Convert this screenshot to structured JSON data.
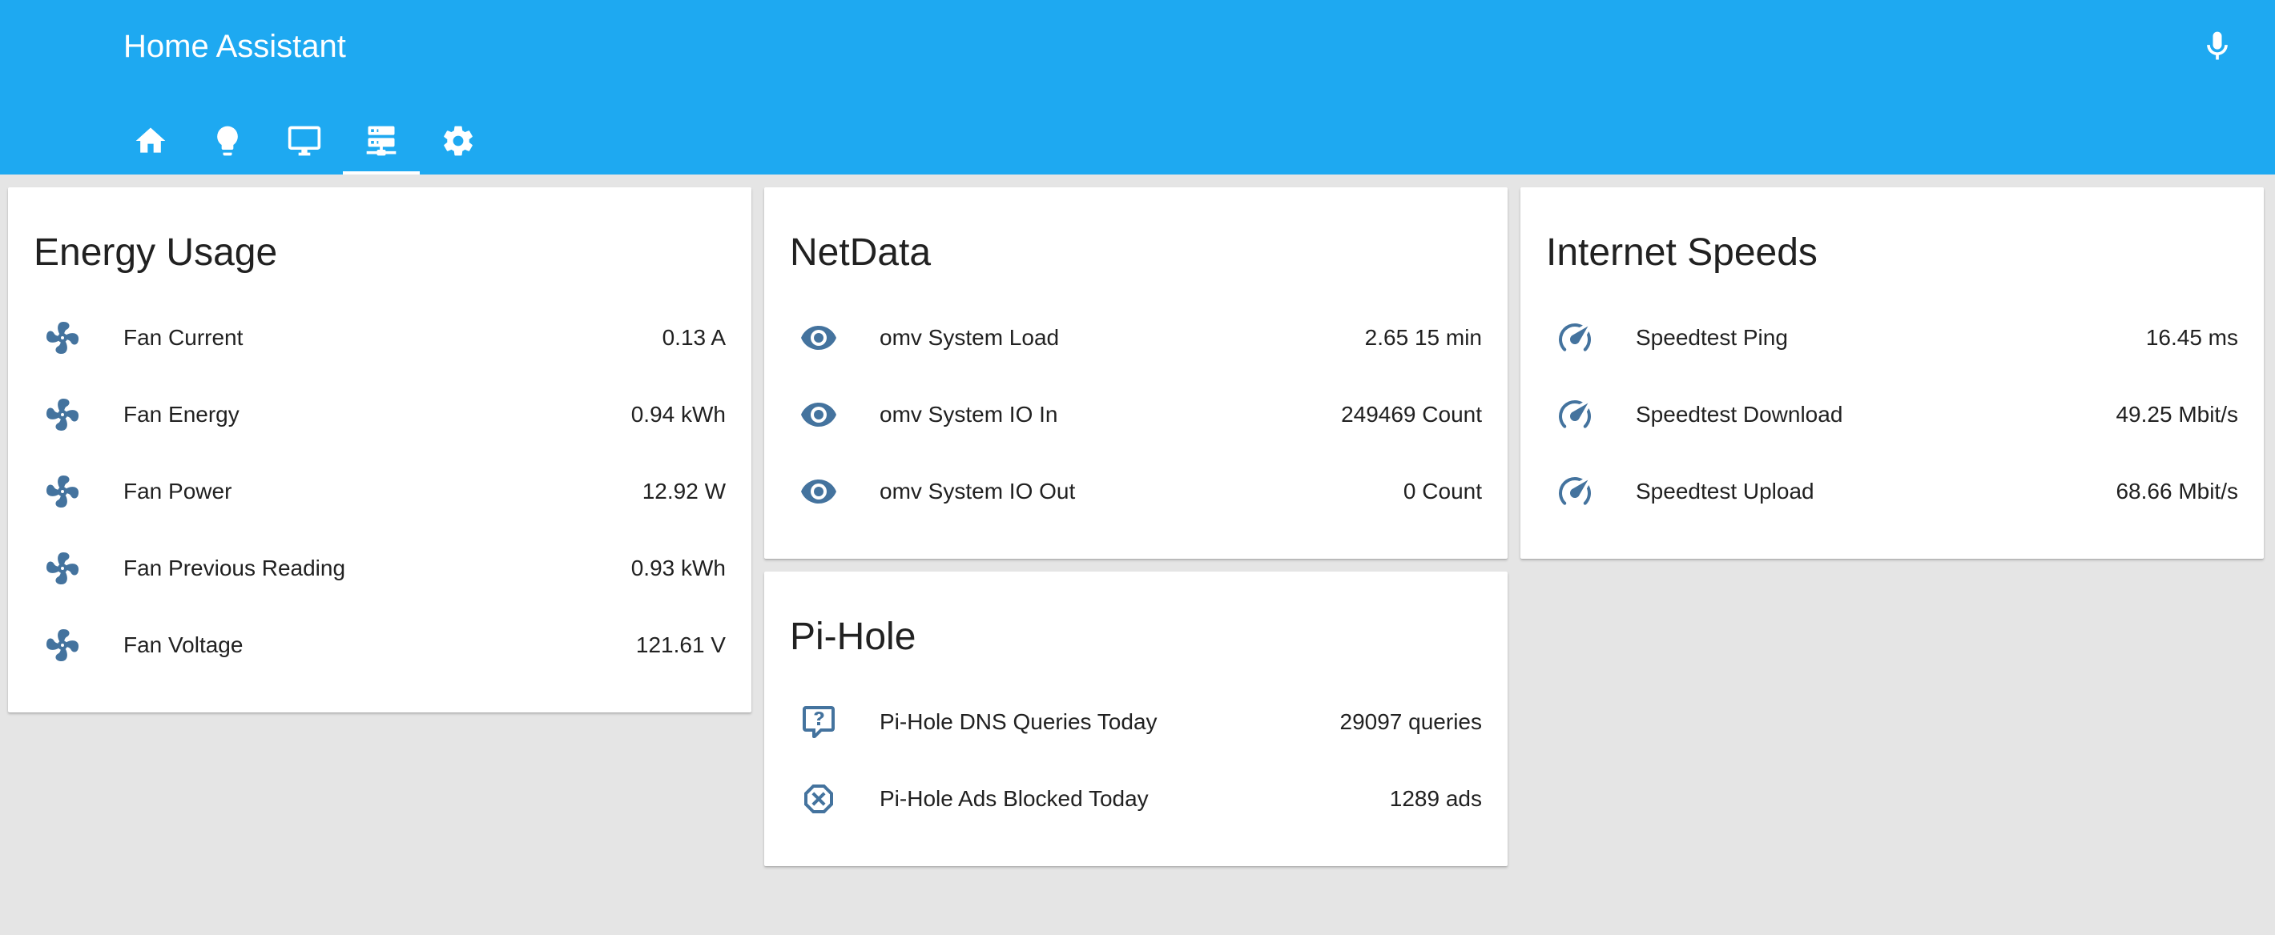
{
  "app": {
    "title": "Home Assistant"
  },
  "colors": {
    "header": "#1ea9f1",
    "icon": "#44739e",
    "background": "#e5e5e5"
  },
  "header": {
    "mic_icon": "microphone-icon",
    "tabs": [
      {
        "icon": "home-icon",
        "active": false
      },
      {
        "icon": "lightbulb-icon",
        "active": false
      },
      {
        "icon": "monitor-icon",
        "active": false
      },
      {
        "icon": "server-network-icon",
        "active": true
      },
      {
        "icon": "gear-icon",
        "active": false
      }
    ]
  },
  "cards": {
    "energy": {
      "title": "Energy Usage",
      "rows": [
        {
          "icon": "fan-icon",
          "label": "Fan Current",
          "value": "0.13 A"
        },
        {
          "icon": "fan-icon",
          "label": "Fan Energy",
          "value": "0.94 kWh"
        },
        {
          "icon": "fan-icon",
          "label": "Fan Power",
          "value": "12.92 W"
        },
        {
          "icon": "fan-icon",
          "label": "Fan Previous Reading",
          "value": "0.93 kWh"
        },
        {
          "icon": "fan-icon",
          "label": "Fan Voltage",
          "value": "121.61 V"
        }
      ]
    },
    "netdata": {
      "title": "NetData",
      "rows": [
        {
          "icon": "eye-icon",
          "label": "omv System Load",
          "value": "2.65 15 min"
        },
        {
          "icon": "eye-icon",
          "label": "omv System IO In",
          "value": "249469 Count"
        },
        {
          "icon": "eye-icon",
          "label": "omv System IO Out",
          "value": "0 Count"
        }
      ]
    },
    "pihole": {
      "title": "Pi-Hole",
      "rows": [
        {
          "icon": "comment-question-icon",
          "label": "Pi-Hole DNS Queries Today",
          "value": "29097 queries"
        },
        {
          "icon": "close-octagon-icon",
          "label": "Pi-Hole Ads Blocked Today",
          "value": "1289 ads"
        }
      ]
    },
    "internet": {
      "title": "Internet Speeds",
      "rows": [
        {
          "icon": "speedometer-icon",
          "label": "Speedtest Ping",
          "value": "16.45 ms"
        },
        {
          "icon": "speedometer-icon",
          "label": "Speedtest Download",
          "value": "49.25 Mbit/s"
        },
        {
          "icon": "speedometer-icon",
          "label": "Speedtest Upload",
          "value": "68.66 Mbit/s"
        }
      ]
    }
  }
}
